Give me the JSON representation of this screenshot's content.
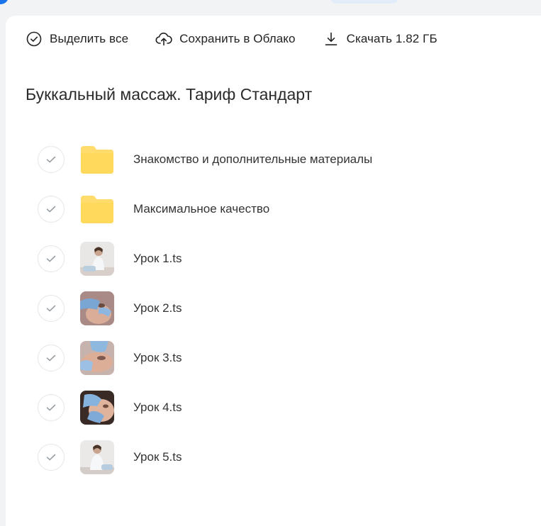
{
  "toolbar": {
    "select_all": "Выделить все",
    "save_to_cloud": "Сохранить в Облако",
    "download": "Скачать 1.82 ГБ"
  },
  "folder": {
    "title": "Буккальный массаж. Тариф Стандарт"
  },
  "items": [
    {
      "name": "Знакомство и дополнительные материалы",
      "type": "folder",
      "icon": "folder-icon"
    },
    {
      "name": "Максимальное качество",
      "type": "folder",
      "icon": "folder-icon"
    },
    {
      "name": "Урок 1.ts",
      "type": "video",
      "icon": "video-thumbnail"
    },
    {
      "name": "Урок 2.ts",
      "type": "video",
      "icon": "video-thumbnail"
    },
    {
      "name": "Урок 3.ts",
      "type": "video",
      "icon": "video-thumbnail"
    },
    {
      "name": "Урок 4.ts",
      "type": "video",
      "icon": "video-thumbnail"
    },
    {
      "name": "Урок 5.ts",
      "type": "video",
      "icon": "video-thumbnail"
    }
  ],
  "colors": {
    "folder": "#ffdc6b",
    "accent": "#1a73e8",
    "check_border": "#e4e6ea"
  }
}
